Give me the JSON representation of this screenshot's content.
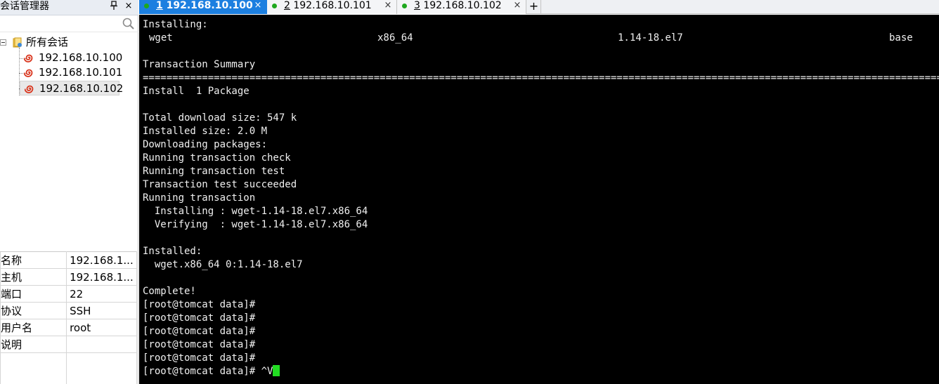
{
  "left_panel": {
    "title": "会话管理器",
    "pin_icon": "pin-icon",
    "close_symbol": "×",
    "search_placeholder": "",
    "tree": {
      "root_label": "所有会话",
      "sessions": [
        "192.168.10.100",
        "192.168.10.101",
        "192.168.10.102"
      ],
      "selected_index": 2
    },
    "properties": [
      {
        "key": "名称",
        "value": "192.168.1..."
      },
      {
        "key": "主机",
        "value": "192.168.1..."
      },
      {
        "key": "端口",
        "value": "22"
      },
      {
        "key": "协议",
        "value": "SSH"
      },
      {
        "key": "用户名",
        "value": "root"
      },
      {
        "key": "说明",
        "value": ""
      }
    ]
  },
  "tabs": [
    {
      "num": "1",
      "title": " 192.168.10.100",
      "active": true,
      "close": "×"
    },
    {
      "num": "2",
      "title": " 192.168.10.101",
      "active": false,
      "close": "×"
    },
    {
      "num": "3",
      "title": " 192.168.10.102",
      "active": false,
      "close": "×"
    }
  ],
  "new_tab_symbol": "+",
  "terminal": {
    "installing_header": "Installing:",
    "pkg_row": {
      "name": "wget",
      "arch": "x86_64",
      "version": "1.14-18.el7",
      "repo": "base"
    },
    "summary_header": "Transaction Summary",
    "separator": "==========================================================================================================================================================",
    "install_count": "Install  1 Package",
    "lines": [
      "Total download size: 547 k",
      "Installed size: 2.0 M",
      "Downloading packages:",
      "Running transaction check",
      "Running transaction test",
      "Transaction test succeeded",
      "Running transaction",
      "  Installing : wget-1.14-18.el7.x86_64",
      "  Verifying  : wget-1.14-18.el7.x86_64"
    ],
    "installed_header": "Installed:",
    "installed_pkg": "  wget.x86_64 0:1.14-18.el7",
    "complete": "Complete!",
    "prompts": [
      "[root@tomcat data]#",
      "[root@tomcat data]#",
      "[root@tomcat data]#",
      "[root@tomcat data]#",
      "[root@tomcat data]#"
    ],
    "last_prompt": "[root@tomcat data]# ^V",
    "colors": {
      "background": "#000000",
      "text": "#f0f0f0",
      "cursor": "#22dd22"
    }
  },
  "colors": {
    "active_tab": "#1c7fe0",
    "connected_dot": "#1ea81e",
    "session_icon": "#d9341c"
  }
}
